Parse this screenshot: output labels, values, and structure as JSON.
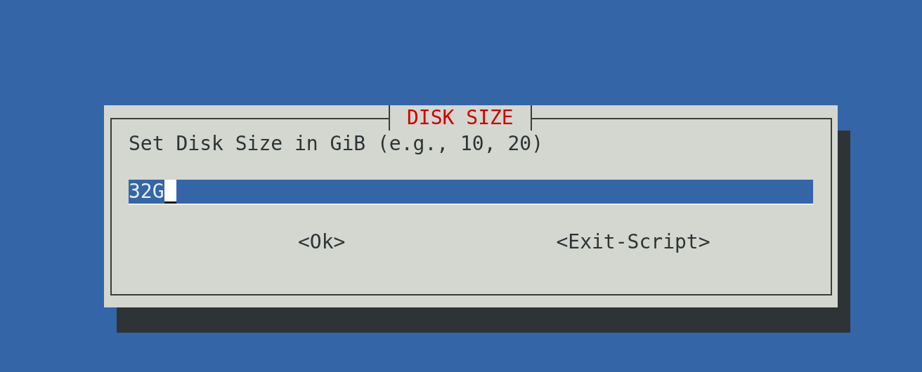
{
  "dialog": {
    "title": "DISK SIZE",
    "prompt": "Set Disk Size in GiB (e.g., 10, 20)",
    "input": {
      "value": "32G",
      "focused": true
    },
    "buttons": [
      {
        "label": "<Ok>",
        "selected": false
      },
      {
        "label": "<Exit-Script>",
        "selected": false
      }
    ]
  }
}
